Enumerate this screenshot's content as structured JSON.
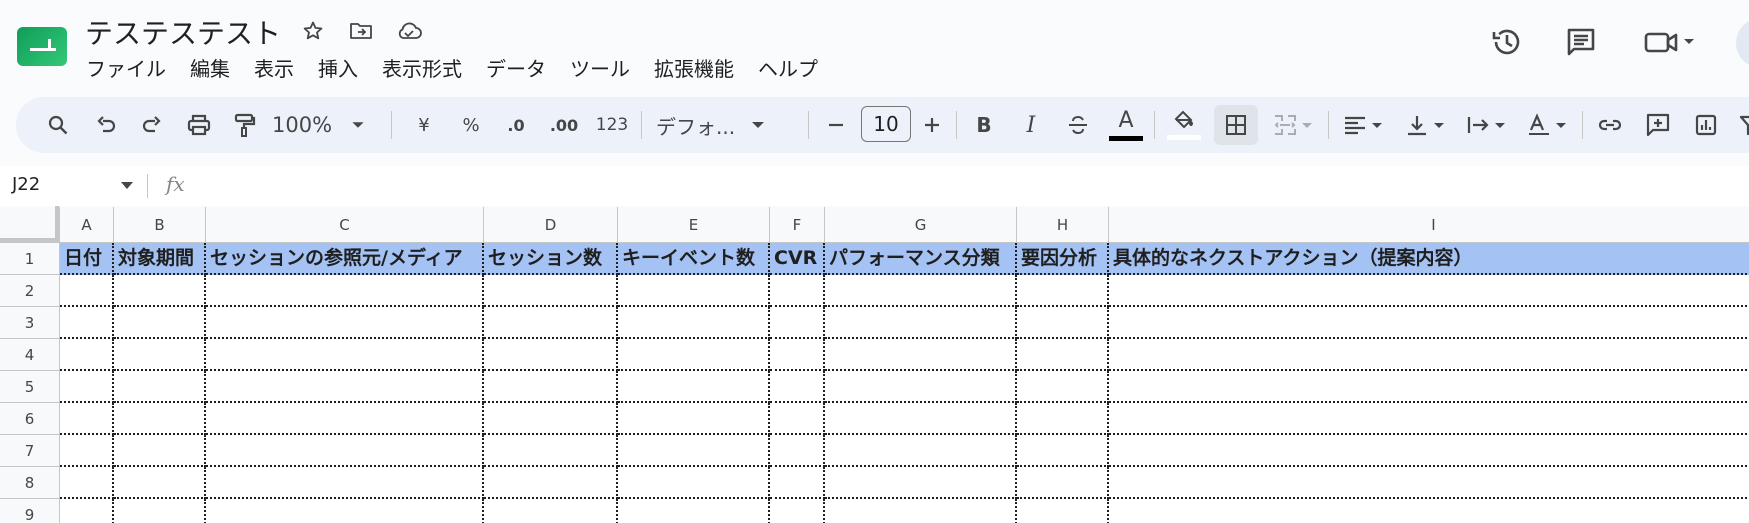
{
  "header": {
    "title": "テステステスト",
    "menu": [
      "ファイル",
      "編集",
      "表示",
      "挿入",
      "表示形式",
      "データ",
      "ツール",
      "拡張機能",
      "ヘルプ"
    ]
  },
  "toolbar": {
    "zoom": "100%",
    "currency": "¥",
    "percent": "%",
    "decrease_decimal": ".0",
    "increase_decimal": ".00",
    "number_format": "123",
    "font": "デフォ...",
    "font_size": "10",
    "bold": "B",
    "italic": "I",
    "text_color_letter": "A"
  },
  "formula_bar": {
    "cell_ref": "J22",
    "fx": "fx"
  },
  "sheet": {
    "columns": [
      "A",
      "B",
      "C",
      "D",
      "E",
      "F",
      "G",
      "H",
      "I"
    ],
    "rows": [
      "1",
      "2",
      "3",
      "4",
      "5",
      "6",
      "7",
      "8",
      "9"
    ],
    "header_row": [
      "日付",
      "対象期間",
      "セッションの参照元/メディア",
      "セッション数",
      "キーイベント数",
      "CVR",
      "パフォーマンス分類",
      "要因分析",
      "具体的なネクストアクション（提案内容）"
    ],
    "header_fill": "#a4c2f4"
  }
}
